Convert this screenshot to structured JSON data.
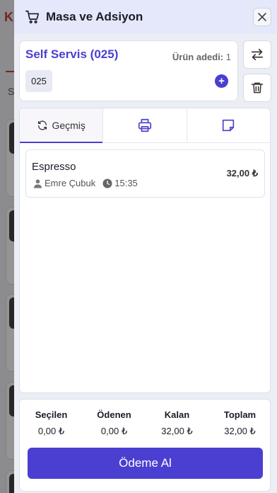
{
  "background": {
    "logo_letter": "K",
    "row_letter": "S"
  },
  "header": {
    "title": "Masa ve Adsiyon"
  },
  "table": {
    "name": "Self Servis (025)",
    "item_count_label": "Ürün adedi:",
    "item_count": "1",
    "chip_label": "025"
  },
  "tabs": [
    {
      "label": "Geçmiş",
      "icon": "refresh-icon"
    },
    {
      "label": "",
      "icon": "printer-icon"
    },
    {
      "label": "",
      "icon": "note-icon"
    }
  ],
  "orders": [
    {
      "product": "Espresso",
      "user": "Emre Çubuk",
      "time": "15:35",
      "price": "32,00 ₺"
    }
  ],
  "summary": {
    "columns": [
      {
        "label": "Seçilen",
        "value": "0,00 ₺"
      },
      {
        "label": "Ödenen",
        "value": "0,00 ₺"
      },
      {
        "label": "Kalan",
        "value": "32,00 ₺"
      },
      {
        "label": "Toplam",
        "value": "32,00 ₺"
      }
    ],
    "pay_button": "Ödeme Al"
  },
  "colors": {
    "accent": "#4a3fd1",
    "header_bg": "#e5e8fa"
  }
}
